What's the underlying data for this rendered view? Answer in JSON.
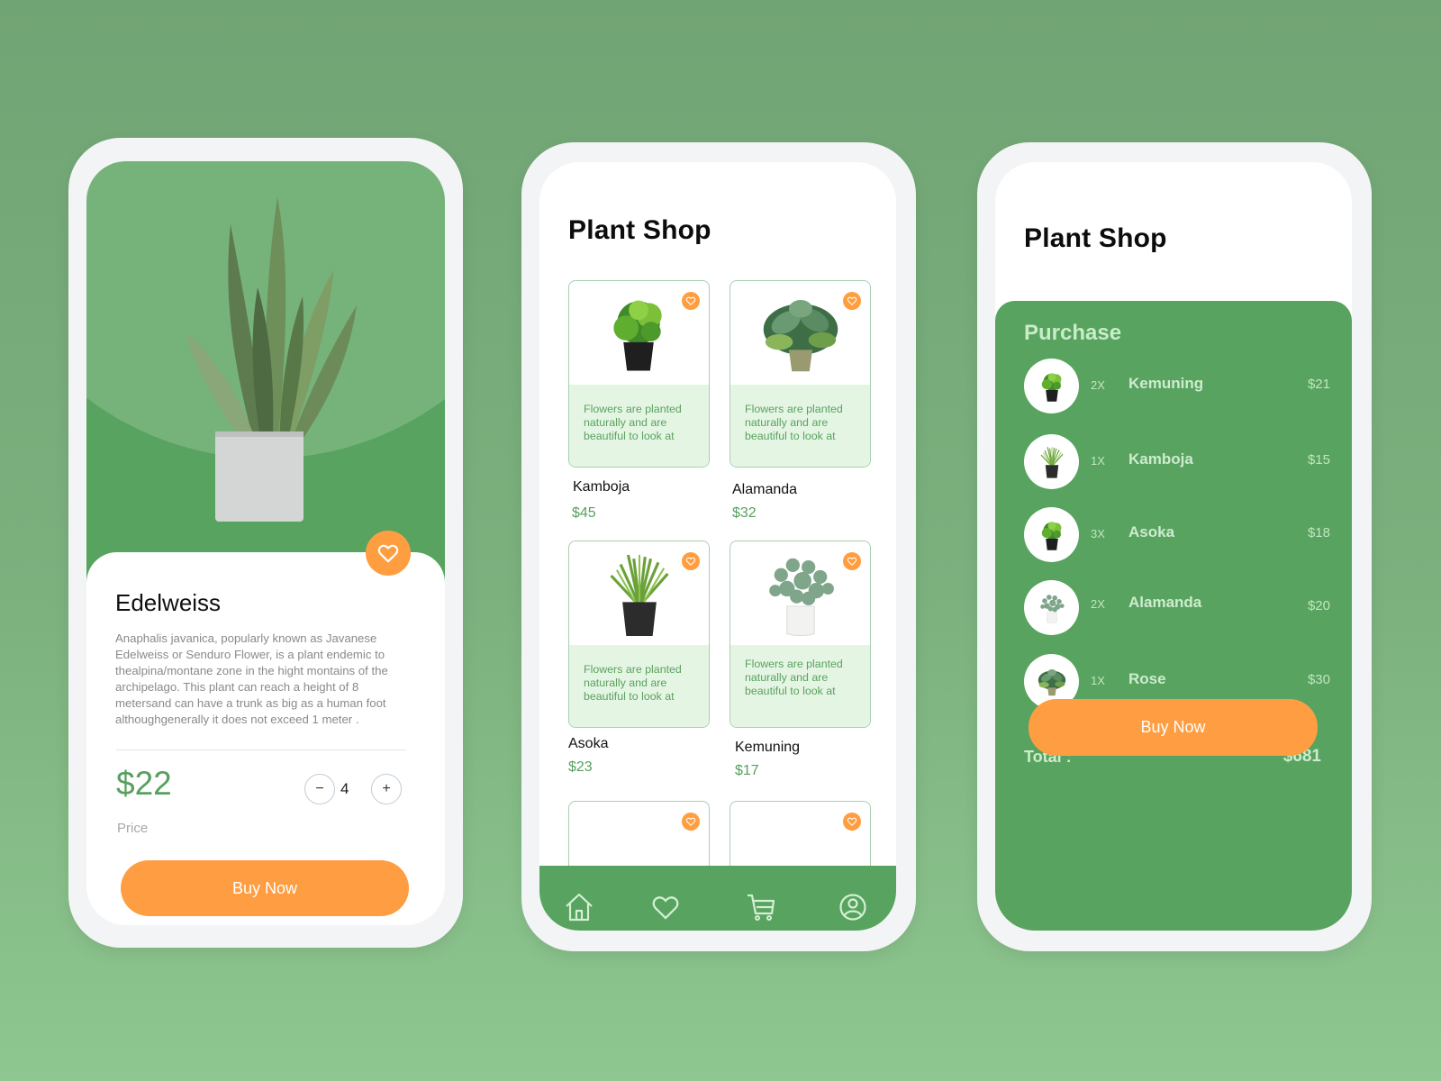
{
  "colors": {
    "brand_green": "#58a35f",
    "accent_orange": "#ff9d42",
    "price_green": "#57a05d",
    "card_tint": "#e5f5e4"
  },
  "detail": {
    "title": "Edelweiss",
    "description": "Anaphalis javanica, popularly known as Javanese Edelweiss or Senduro Flower, is a plant endemic to thealpina/montane zone in the hight montains of the archipelago. This plant can reach a height of 8 metersand can have a trunk as big as a human foot althoughgenerally it does not exceed 1 meter .",
    "price": "$22",
    "price_label": "Price",
    "quantity": "4",
    "minus_label": "−",
    "plus_label": "+",
    "buy_label": "Buy Now",
    "favorite_icon": "heart-icon"
  },
  "shop": {
    "title": "Plant Shop",
    "card_description": "Flowers are planted naturally and are beautiful to look at",
    "products": [
      {
        "name": "Kamboja",
        "price": "$45"
      },
      {
        "name": "Alamanda",
        "price": "$32"
      },
      {
        "name": "Asoka",
        "price": "$23"
      },
      {
        "name": "Kemuning",
        "price": "$17"
      }
    ],
    "nav": [
      {
        "icon": "home-icon"
      },
      {
        "icon": "heart-icon"
      },
      {
        "icon": "cart-icon"
      },
      {
        "icon": "profile-icon"
      }
    ]
  },
  "cart": {
    "title": "Plant Shop",
    "section_title": "Purchase",
    "items": [
      {
        "qty": "2X",
        "name": "Kemuning",
        "price": "$21"
      },
      {
        "qty": "1X",
        "name": "Kamboja",
        "price": "$15"
      },
      {
        "qty": "3X",
        "name": "Asoka",
        "price": "$18"
      },
      {
        "qty": "2X",
        "name": "Alamanda",
        "price": "$20"
      },
      {
        "qty": "1X",
        "name": "Rose",
        "price": "$30"
      }
    ],
    "total_label": "Total :",
    "total_value": "$681",
    "buy_label": "Buy Now"
  }
}
